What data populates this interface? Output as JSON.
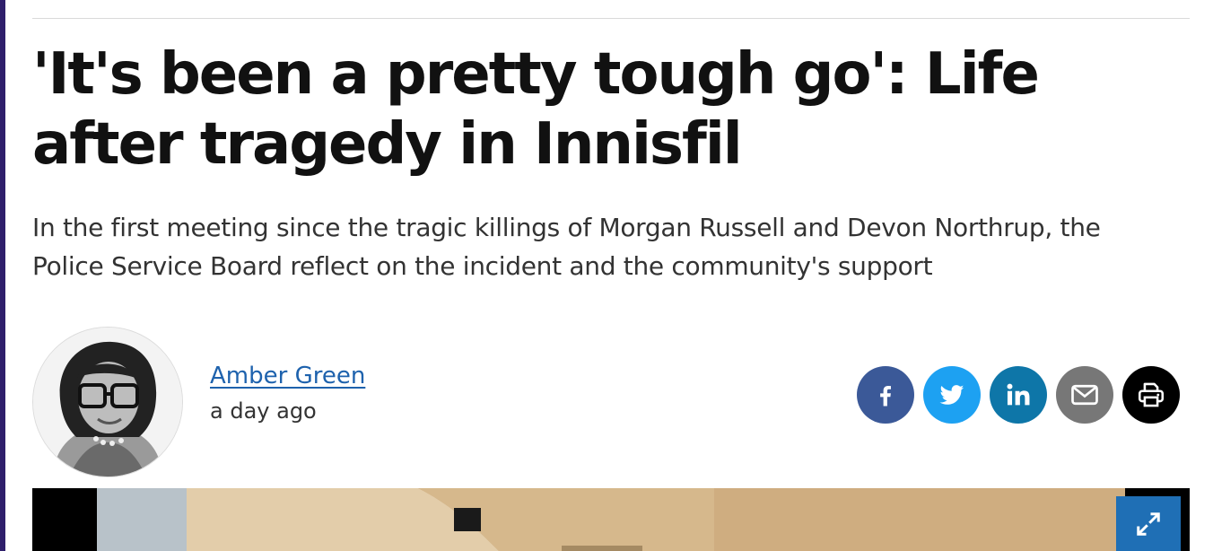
{
  "article": {
    "headline": "'It's been a pretty tough go': Life after tragedy in Innisfil",
    "subheadline": "In the first meeting since the tragic killings of Morgan Russell and Devon Northrup, the Police Service Board reflect on the incident and the community's support"
  },
  "byline": {
    "author_name": "Amber Green",
    "timestamp": "a day ago"
  },
  "share": {
    "buttons": [
      {
        "name": "facebook",
        "icon": "facebook-icon",
        "color": "#3b5998"
      },
      {
        "name": "twitter",
        "icon": "twitter-icon",
        "color": "#1da1f2"
      },
      {
        "name": "linkedin",
        "icon": "linkedin-icon",
        "color": "#0e76a8"
      },
      {
        "name": "email",
        "icon": "envelope-icon",
        "color": "#777777"
      },
      {
        "name": "print",
        "icon": "printer-icon",
        "color": "#000000"
      }
    ]
  },
  "hero_image": {
    "expand_icon": "expand-icon",
    "expand_color": "#1f6fb5"
  }
}
